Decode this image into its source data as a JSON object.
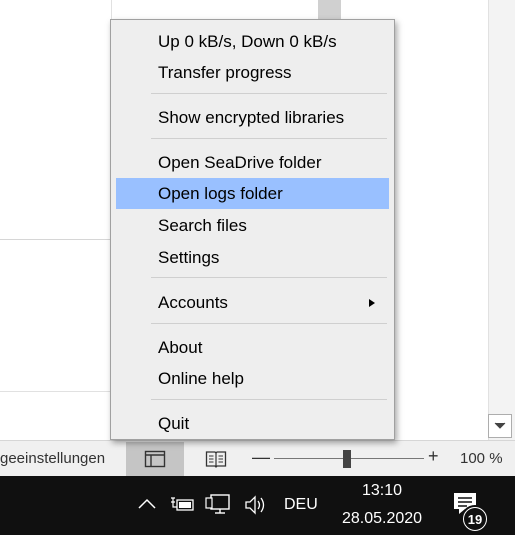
{
  "context_menu": {
    "items": [
      {
        "label": "Up 0 kB/s, Down 0 kB/s"
      },
      {
        "label": "Transfer progress"
      },
      {
        "label": "Show encrypted libraries"
      },
      {
        "label": "Open SeaDrive folder"
      },
      {
        "label": "Open logs folder"
      },
      {
        "label": "Search files"
      },
      {
        "label": "Settings"
      },
      {
        "label": "Accounts"
      },
      {
        "label": "About"
      },
      {
        "label": "Online help"
      },
      {
        "label": "Quit"
      }
    ],
    "highlighted_label": "Open logs folder",
    "highlight_color": "#99c0ff"
  },
  "status_bar": {
    "text": "geeinstellungen",
    "zoom_level": "100 %",
    "zoom_minus": "—",
    "zoom_plus": "+"
  },
  "taskbar": {
    "language": "DEU",
    "time": "13:10",
    "date": "28.05.2020",
    "notification_count": "19",
    "tray_icons": [
      "chevron-up-icon",
      "power-icon",
      "network-icon",
      "volume-icon",
      "notification-icon"
    ]
  }
}
